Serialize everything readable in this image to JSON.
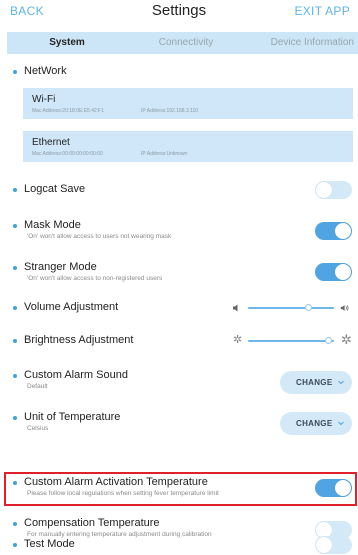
{
  "header": {
    "back_label": "BACK",
    "title": "Settings",
    "exit_label": "EXIT APP"
  },
  "tabs": [
    {
      "label": "System",
      "active": true
    },
    {
      "label": "Connectivity",
      "active": false
    },
    {
      "label": "Device Information",
      "active": false
    }
  ],
  "network": {
    "section_label": "NetWork",
    "wifi": {
      "name": "Wi-Fi",
      "mac": "Mac Address:20:18:0E:E5:42:F1",
      "ip": "IP Address:192.168.3.110"
    },
    "ethernet": {
      "name": "Ethernet",
      "mac": "Mac Address:00:00:00:00:00:00",
      "ip": "IP Address:Unknown"
    }
  },
  "settings": {
    "logcat": {
      "label": "Logcat Save",
      "on": false
    },
    "mask": {
      "label": "Mask Mode",
      "sub": "'On' won't allow access to users not wearing mask",
      "on": true
    },
    "stranger": {
      "label": "Stranger Mode",
      "sub": "'On' won't allow access to non-registered users",
      "on": true
    },
    "volume": {
      "label": "Volume Adjustment",
      "level": 0.72
    },
    "brightness": {
      "label": "Brightness Adjustment",
      "level": 0.97
    },
    "alarm_sound": {
      "label": "Custom Alarm Sound",
      "sub": "Default",
      "button": "CHANGE"
    },
    "unit_temp": {
      "label": "Unit of Temperature",
      "sub": "Celsius",
      "button": "CHANGE"
    },
    "alarm_temp": {
      "label": "Custom Alarm Activation Temperature",
      "sub": "Please follow local regulations when setting fever temperature limit",
      "on": true
    },
    "compensation": {
      "label": "Compensation Temperature",
      "sub": "For manually entering temperature adjustment during calibration",
      "on": false
    },
    "test_mode": {
      "label": "Test Mode",
      "on": false
    }
  },
  "colors": {
    "accent": "#4fa4e1",
    "tab_bg": "#cde6f7",
    "highlight": "#e0202a",
    "back_exit": "#5fb3e6"
  }
}
